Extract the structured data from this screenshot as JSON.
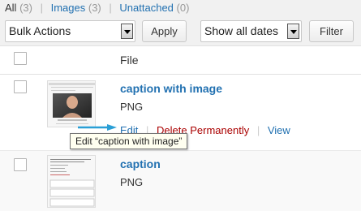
{
  "filters": {
    "all_label": "All",
    "all_count": "(3)",
    "images_label": "Images",
    "images_count": "(3)",
    "unattached_label": "Unattached",
    "unattached_count": "(0)",
    "separator": "|"
  },
  "toolbar": {
    "bulk_actions": "Bulk Actions",
    "apply": "Apply",
    "dates": "Show all dates",
    "filter": "Filter"
  },
  "table": {
    "column_file": "File",
    "rows": [
      {
        "title": "caption with image",
        "mime": "PNG",
        "actions": {
          "edit": "Edit",
          "delete": "Delete Permanently",
          "view": "View",
          "separator": "|"
        }
      },
      {
        "title": "caption",
        "mime": "PNG"
      }
    ]
  },
  "tooltip": "Edit “caption with image”",
  "colors": {
    "link": "#2271b1",
    "delete": "#a00000",
    "pointer": "#2a9fd6"
  },
  "icons": {
    "pointer": "arrow-right-icon"
  }
}
